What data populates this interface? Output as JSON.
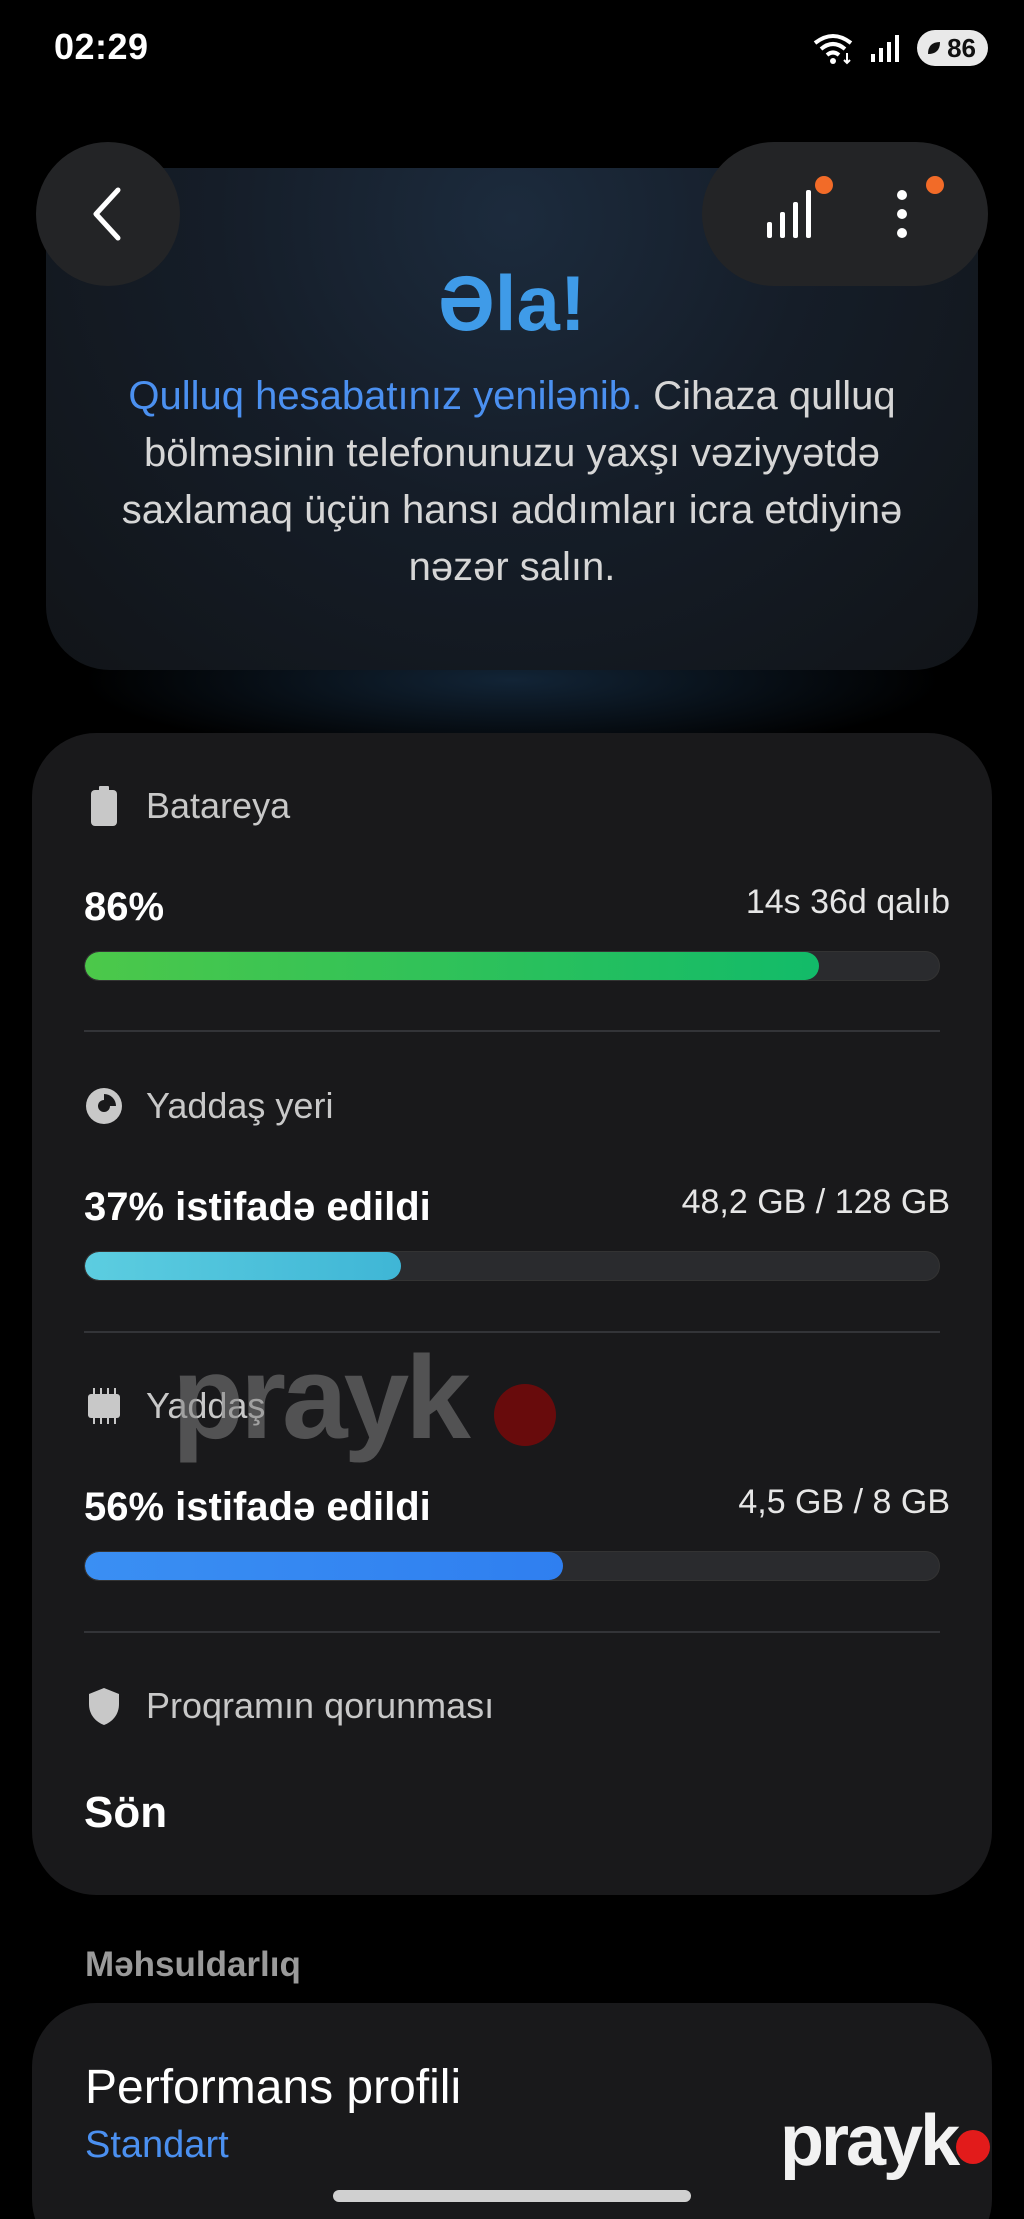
{
  "status_bar": {
    "time": "02:29",
    "battery_level": "86"
  },
  "hero": {
    "title": "Əla!",
    "highlight": "Qulluq hesabatınız yenilənib.",
    "body": " Cihaza qulluq bölməsinin telefonunuzu yaxşı vəziyyətdə saxlamaq üçün hansı addımları icra etdiyinə nəzər salın."
  },
  "battery": {
    "label": "Batareya",
    "value": "86%",
    "remaining": "14s 36d qalıb",
    "fill": 0.86,
    "color": "#3fc24a"
  },
  "storage": {
    "label": "Yaddaş yeri",
    "value": "37% istifadə edildi",
    "detail": "48,2 GB / 128 GB",
    "fill": 0.37,
    "color": "#4fc3dc"
  },
  "memory": {
    "label": "Yaddaş",
    "value": "56% istifadə edildi",
    "detail": "4,5 GB / 8 GB",
    "fill": 0.56,
    "color": "#3a8ff3"
  },
  "app_protection": {
    "label": "Proqramın qorunması",
    "value": "Sön"
  },
  "performance": {
    "section_label": "Məhsuldarlıq",
    "title": "Performans profili",
    "value": "Standart"
  },
  "watermark": {
    "text": "prayk"
  },
  "logo": {
    "text": "prayk"
  },
  "icons": {
    "back": "chevron-left-icon",
    "signal": "bar-chart-icon",
    "more": "more-vert-icon",
    "battery": "battery-icon",
    "storage": "pie-chart-icon",
    "memory": "memory-chip-icon",
    "shield": "shield-icon"
  },
  "colors": {
    "accent": "#4b90f0",
    "badge": "#f26b28"
  }
}
